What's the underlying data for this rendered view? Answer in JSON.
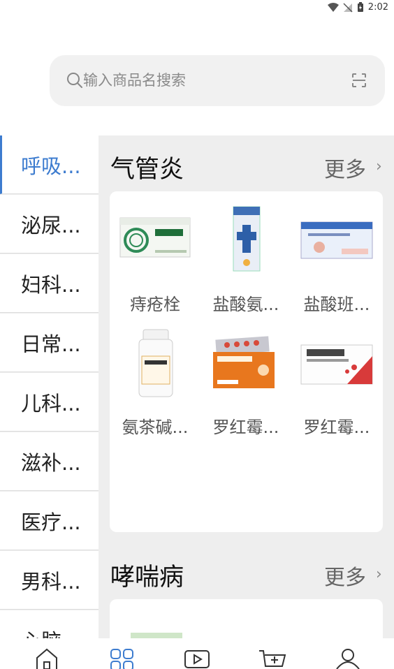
{
  "status_bar": {
    "time": "2:02"
  },
  "search": {
    "placeholder": "输入商品名搜索"
  },
  "sidebar": {
    "items": [
      {
        "label": "呼吸..."
      },
      {
        "label": "泌尿..."
      },
      {
        "label": "妇科..."
      },
      {
        "label": "日常..."
      },
      {
        "label": "儿科..."
      },
      {
        "label": "滋补..."
      },
      {
        "label": "医疗..."
      },
      {
        "label": "男科..."
      },
      {
        "label": "心脑"
      }
    ]
  },
  "sections": [
    {
      "title": "气管炎",
      "more_label": "更多",
      "products": [
        {
          "name": "痔疮栓"
        },
        {
          "name": "盐酸氨..."
        },
        {
          "name": "盐酸班..."
        },
        {
          "name": "氨茶碱..."
        },
        {
          "name": "罗红霉..."
        },
        {
          "name": "罗红霉..."
        }
      ]
    },
    {
      "title": "哮喘病",
      "more_label": "更多"
    }
  ],
  "tabbar": {
    "tabs": [
      {
        "icon": "home-icon"
      },
      {
        "icon": "category-icon",
        "active": true
      },
      {
        "icon": "video-icon"
      },
      {
        "icon": "cart-icon"
      },
      {
        "icon": "profile-icon"
      }
    ]
  },
  "colors": {
    "accent": "#3d7ccf",
    "background": "#eeeeee"
  }
}
